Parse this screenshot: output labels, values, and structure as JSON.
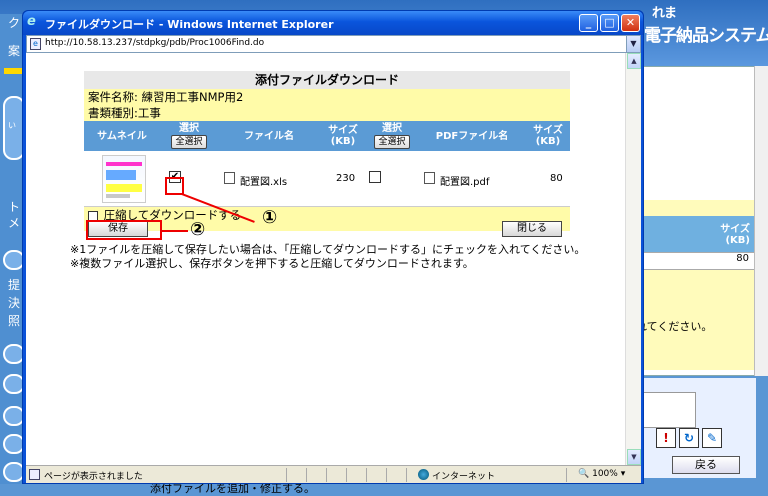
{
  "background": {
    "logo_line1": "れま",
    "logo_line2": "電子納品システム",
    "left_chars": [
      "ク",
      "案",
      "い",
      "ト",
      "メ",
      "提",
      "決",
      "照"
    ],
    "right_size_label": "サイズ\n(KB)",
    "right_size_value": "80",
    "right_text": "れてください。",
    "back_button": "戻る",
    "bottom_text": "添付ファイルを追加・修正する。"
  },
  "window": {
    "title": "ファイルダウンロード - Windows Internet Explorer",
    "url": "http://10.58.13.237/stdpkg/pdb/Proc1006Find.do",
    "min_symbol": "_",
    "max_symbol": "□",
    "close_symbol": "✕"
  },
  "form": {
    "title": "添付ファイルダウンロード",
    "case_name": "案件名称: 練習用工事NMP用2",
    "doc_type": "書類種別:工事",
    "headers": {
      "thumbnail": "サムネイル",
      "select1": "選択",
      "select_all1": "全選択",
      "filename": "ファイル名",
      "size1_a": "サイズ",
      "size1_b": "(KB)",
      "select2": "選択",
      "select_all2": "全選択",
      "pdf_filename": "PDFファイル名",
      "size2_a": "サイズ",
      "size2_b": "(KB)"
    },
    "row": {
      "checked_mark": "✔",
      "filename": "配置図.xls",
      "size": "230",
      "pdf_filename": "配置図.pdf",
      "pdf_size": "80"
    },
    "compress_label": "圧縮してダウンロードする",
    "save_button": "保存",
    "close_button": "閉じる"
  },
  "notes": [
    "※1ファイルを圧縮して保存したい場合は、「圧縮してダウンロードする」にチェックを入れてください。",
    "※複数ファイル選択し、保存ボタンを押下すると圧縮してダウンロードされます。"
  ],
  "annotations": {
    "marker1": "①",
    "marker2": "②",
    "color": "#e00000"
  },
  "status": {
    "text": "ページが表示されました",
    "zone": "インターネット",
    "zoom": "100%"
  }
}
